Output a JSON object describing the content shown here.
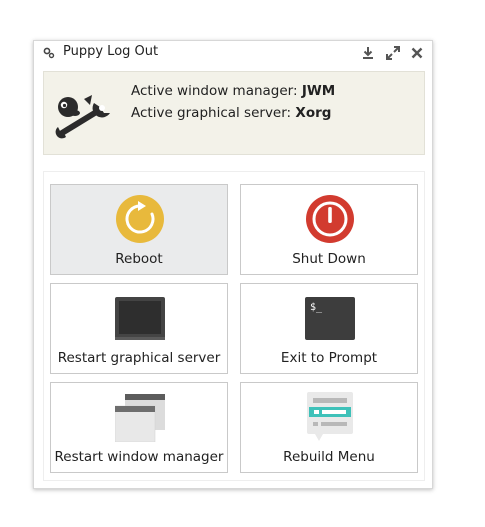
{
  "window": {
    "title": "Puppy Log Out",
    "controls": {
      "minimize_icon": "download-arrow-icon",
      "maximize_icon": "expand-arrows-icon",
      "close_icon": "close-x-icon"
    }
  },
  "info": {
    "wm_label": "Active window manager:",
    "wm_value": "JWM",
    "server_label": "Active graphical server:",
    "server_value": "Xorg"
  },
  "buttons": [
    {
      "label": "Reboot",
      "icon": "reboot-icon",
      "color": "#e8b93c"
    },
    {
      "label": "Shut Down",
      "icon": "power-icon",
      "color": "#d23b2f"
    },
    {
      "label": "Restart graphical server",
      "icon": "monitor-icon",
      "color": "#3a3a3a"
    },
    {
      "label": "Exit to Prompt",
      "icon": "terminal-icon",
      "color": "#3d3d3d"
    },
    {
      "label": "Restart window manager",
      "icon": "windows-icon",
      "color": "#cfcfcf"
    },
    {
      "label": "Rebuild Menu",
      "icon": "menu-icon",
      "color": "#3ec1b9"
    }
  ],
  "terminal_prompt": "$_"
}
